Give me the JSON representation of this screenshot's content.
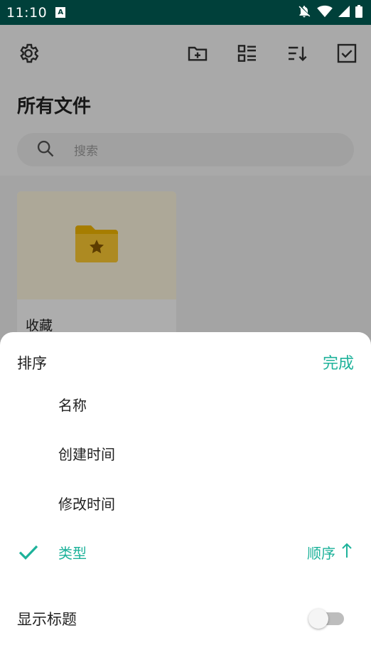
{
  "status_bar": {
    "time": "11:10",
    "badge": "A"
  },
  "app": {
    "title": "所有文件",
    "search": {
      "placeholder": "搜索"
    },
    "folder": {
      "name": "收藏"
    }
  },
  "sort_sheet": {
    "title": "排序",
    "done_label": "完成",
    "options": [
      {
        "label": "名称",
        "selected": false
      },
      {
        "label": "创建时间",
        "selected": false
      },
      {
        "label": "修改时间",
        "selected": false
      },
      {
        "label": "类型",
        "selected": true
      }
    ],
    "order_label": "顺序",
    "show_title_label": "显示标题",
    "show_title_enabled": false
  },
  "colors": {
    "accent": "#1db29a",
    "status_bar": "#00403a"
  }
}
